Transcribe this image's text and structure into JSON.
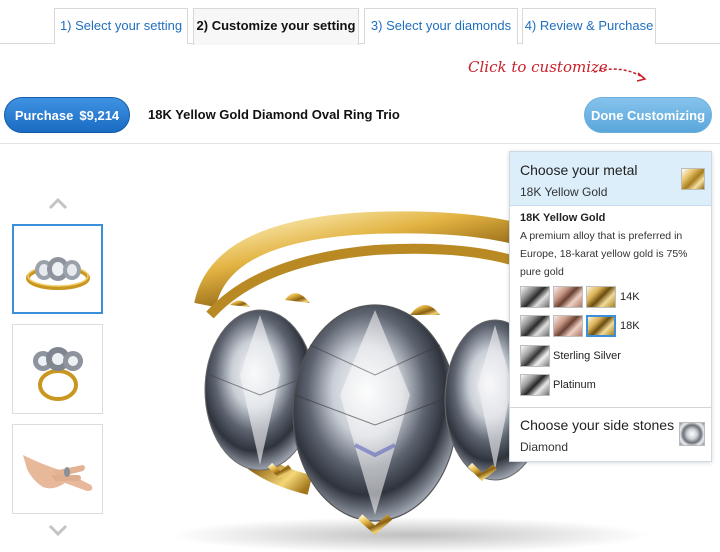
{
  "tabs": [
    {
      "label": "1) Select your setting"
    },
    {
      "label": "2) Customize your setting"
    },
    {
      "label": "3) Select your diamonds"
    },
    {
      "label": "4) Review & Purchase"
    }
  ],
  "hint": {
    "text": "Click to customize"
  },
  "purchase": {
    "label": "Purchase",
    "price": "$9,214"
  },
  "product": {
    "title": "18K Yellow Gold Diamond Oval Ring Trio"
  },
  "done": {
    "label": "Done Customizing"
  },
  "customizer": {
    "metal": {
      "heading": "Choose your metal",
      "selected": "18K Yellow Gold",
      "desc_title": "18K Yellow Gold",
      "desc_text": "A premium alloy that is preferred in Europe, 18-karat yellow gold is 75% pure gold",
      "rows": [
        {
          "label": "14K",
          "swatches": [
            "white-gold",
            "rose-gold",
            "yellow-gold"
          ]
        },
        {
          "label": "18K",
          "swatches": [
            "white-gold",
            "rose-gold",
            "yellow-gold"
          ],
          "selected": "yellow-gold"
        },
        {
          "label": "Sterling Silver",
          "swatches": [
            "silver"
          ]
        },
        {
          "label": "Platinum",
          "swatches": [
            "platinum"
          ]
        }
      ]
    },
    "side_stones": {
      "heading": "Choose your side stones",
      "selected": "Diamond"
    }
  },
  "colors": {
    "accent": "#1f6fbf",
    "purchase_button": "#1a6bc3",
    "done_button": "#6aaedb",
    "hint": "#c8202b",
    "panel_header": "#dbeefa"
  },
  "icons": [
    "chevron-up-icon",
    "chevron-down-icon",
    "arrow-icon"
  ]
}
